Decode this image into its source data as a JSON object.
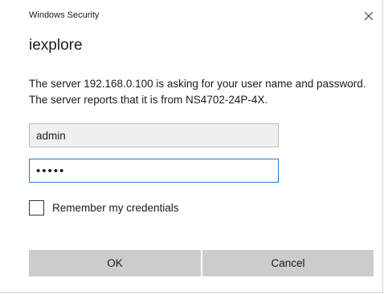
{
  "window": {
    "title": "Windows Security",
    "heading": "iexplore"
  },
  "message": "The server 192.168.0.100 is asking for your user name and password. The server reports that it is from NS4702-24P-4X.",
  "form": {
    "username_value": "admin",
    "password_value": "•••••",
    "remember_label": "Remember my credentials",
    "remember_checked": false
  },
  "buttons": {
    "ok_label": "OK",
    "cancel_label": "Cancel"
  },
  "colors": {
    "focus_border": "#2b78d4",
    "button_bg": "#cccccc",
    "disabled_field_bg": "#f0f0f0"
  },
  "icons": {
    "close": "close-icon"
  }
}
